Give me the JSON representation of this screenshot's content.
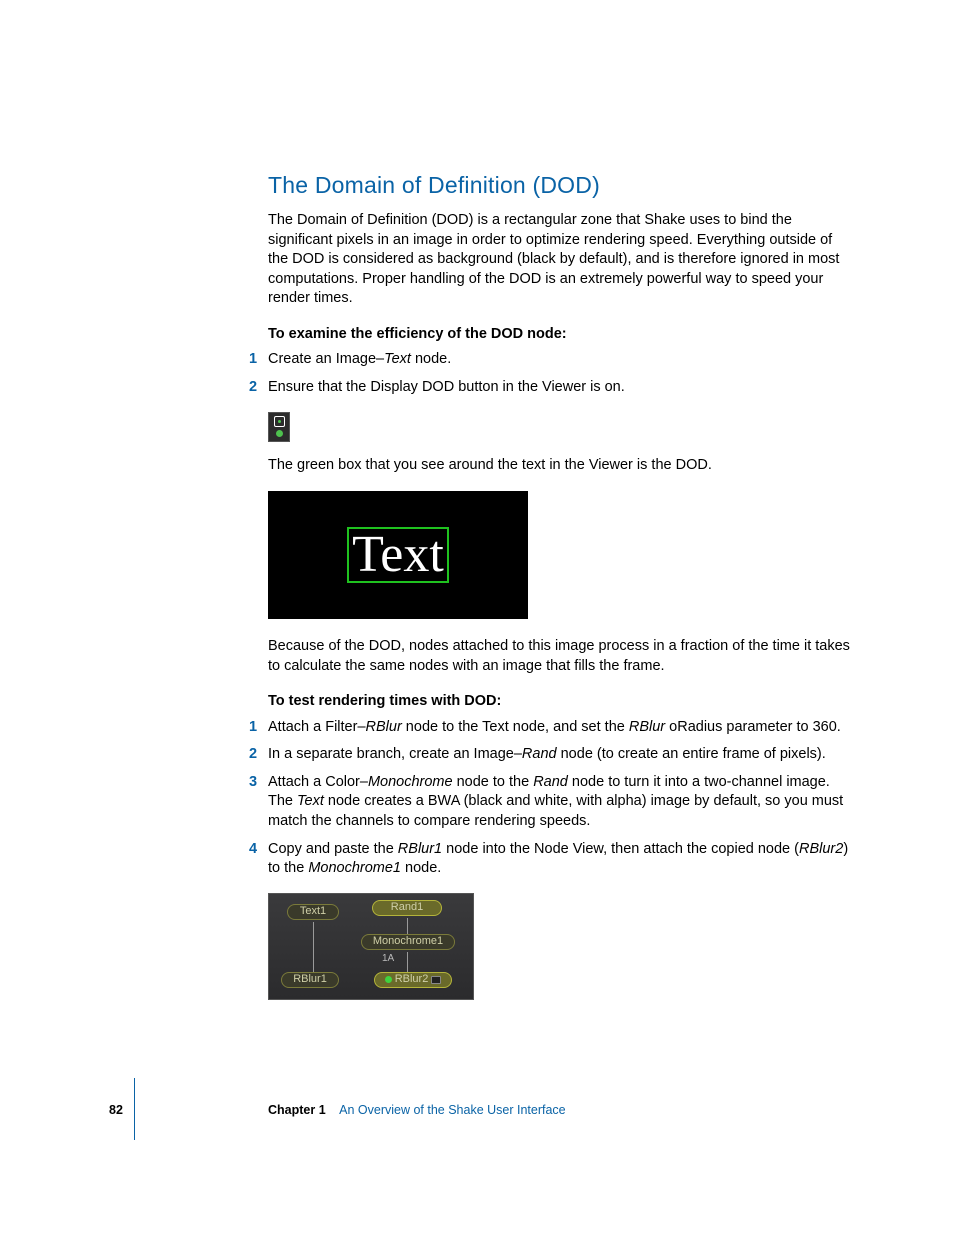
{
  "heading": "The Domain of Definition (DOD)",
  "intro": "The Domain of Definition (DOD) is a rectangular zone that Shake uses to bind the significant pixels in an image in order to optimize rendering speed. Everything outside of the DOD is considered as background (black by default), and is therefore ignored in most computations. Proper handling of the DOD is an extremely powerful way to speed your render times.",
  "sub1": "To examine the efficiency of the DOD node:",
  "list1": {
    "i1": {
      "num": "1",
      "a": "Create an Image–",
      "b": "Text",
      "c": " node."
    },
    "i2": {
      "num": "2",
      "t": "Ensure that the Display DOD button in the Viewer is on."
    }
  },
  "afterIcon": "The green box that you see around the text in the Viewer is the DOD.",
  "viewerText": "Text",
  "afterViewer": "Because of the DOD, nodes attached to this image process in a fraction of the time it takes to calculate the same nodes with an image that fills the frame.",
  "sub2": "To test rendering times with DOD:",
  "list2": {
    "i1": {
      "num": "1",
      "a": "Attach a Filter–",
      "b": "RBlur",
      "c": " node to the Text node, and set the ",
      "d": "RBlur",
      "e": " oRadius parameter to 360."
    },
    "i2": {
      "num": "2",
      "a": "In a separate branch, create an Image–",
      "b": "Rand",
      "c": " node (to create an entire frame of pixels)."
    },
    "i3": {
      "num": "3",
      "a": "Attach a Color–",
      "b": "Monochrome",
      "c": " node to the ",
      "d": "Rand",
      "e": " node to turn it into a two-channel image. The ",
      "f": "Text",
      "g": " node creates a BWA (black and white, with alpha) image by default, so you must match the channels to compare rendering speeds."
    },
    "i4": {
      "num": "4",
      "a": "Copy and paste the ",
      "b": "RBlur1",
      "c": " node into the Node View, then attach the copied node (",
      "d": "RBlur2",
      "e": ") to the ",
      "f": "Monochrome1",
      "g": " node."
    }
  },
  "nodes": {
    "text1": "Text1",
    "rand1": "Rand1",
    "mono1": "Monochrome1",
    "tag": "1A",
    "rblur1": "RBlur1",
    "rblur2": "RBlur2"
  },
  "footer": {
    "page": "82",
    "chapter": "Chapter 1",
    "title": "An Overview of the Shake User Interface"
  }
}
